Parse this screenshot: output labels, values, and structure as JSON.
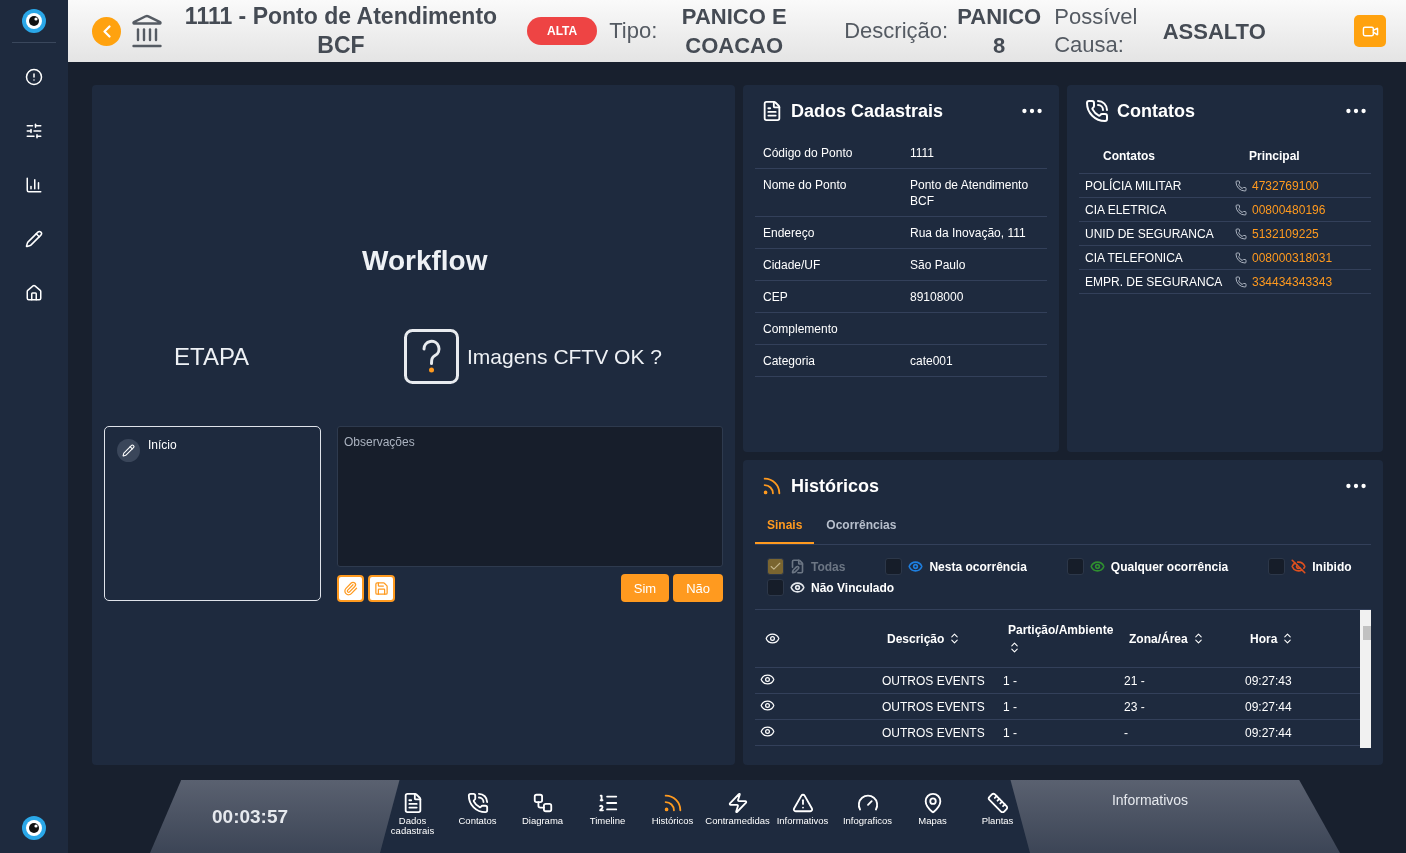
{
  "header": {
    "title": "1111 - Ponto de Atendimento BCF",
    "priority": "ALTA",
    "fields": [
      {
        "label": "Tipo:",
        "value": "PANICO E COACAO"
      },
      {
        "label": "Descrição:",
        "value": "PANICO 8"
      },
      {
        "label": "Possível Causa:",
        "value": "ASSALTO"
      }
    ]
  },
  "workflow": {
    "title": "Workflow",
    "stage_label": "ETAPA",
    "question": "Imagens CFTV OK ?",
    "steps": [
      {
        "label": "Início"
      }
    ],
    "notes": {
      "placeholder": "Observações"
    },
    "buttons": [
      "Sim",
      "Não"
    ]
  },
  "dados": {
    "title": "Dados Cadastrais",
    "rows": [
      {
        "label": "Código do Ponto",
        "value": "1111"
      },
      {
        "label": "Nome do Ponto",
        "value": "Ponto de Atendimento BCF"
      },
      {
        "label": "Endereço",
        "value": "Rua da Inovação, 111"
      },
      {
        "label": "Cidade/UF",
        "value": "São Paulo"
      },
      {
        "label": "CEP",
        "value": "89108000"
      },
      {
        "label": "Complemento"
      },
      {
        "label": "Categoria",
        "value": "cate001"
      }
    ]
  },
  "contatos": {
    "title": "Contatos",
    "columns": [
      "Contatos",
      "Principal"
    ],
    "rows": [
      {
        "name": "POLÍCIA MILITAR",
        "phone": "4732769100"
      },
      {
        "name": "CIA ELETRICA",
        "phone": "00800480196"
      },
      {
        "name": "UNID DE SEGURANCA",
        "phone": "5132109225"
      },
      {
        "name": "CIA TELEFONICA",
        "phone": "008000318031"
      },
      {
        "name": "EMPR. DE SEGURANCA",
        "phone": "334434343343"
      }
    ]
  },
  "historicos": {
    "title": "Históricos",
    "tabs": [
      {
        "label": "Sinais",
        "selected": true
      },
      {
        "label": "Ocorrências",
        "selected": false
      }
    ],
    "filters": [
      {
        "label": "Todas",
        "kind": "note",
        "checked": true,
        "disabled": true,
        "color": "#6c7684"
      },
      {
        "label": "Nesta ocorrência",
        "kind": "eye",
        "checked": false,
        "disabled": false,
        "color": "#1e7fe0"
      },
      {
        "label": "Qualquer ocorrência",
        "kind": "eye",
        "checked": false,
        "disabled": false,
        "color": "#2f8f2f"
      },
      {
        "label": "Inibido",
        "kind": "eye-off",
        "checked": false,
        "disabled": false,
        "color": "#e0501e"
      },
      {
        "label": "Não Vinculado",
        "kind": "eye",
        "checked": false,
        "disabled": false,
        "color": "#e6e9ee"
      }
    ],
    "columns": [
      "Descrição",
      "Partição/Ambiente",
      "Zona/Área",
      "Hora"
    ],
    "rows": [
      {
        "description": "OUTROS EVENTS",
        "partition": "1 -",
        "zone": "21 -",
        "time": "09:27:43"
      },
      {
        "description": "OUTROS EVENTS",
        "partition": "1 -",
        "zone": "23 -",
        "time": "09:27:44"
      },
      {
        "description": "OUTROS EVENTS",
        "partition": "1 -",
        "zone": "-",
        "time": "09:27:44"
      }
    ]
  },
  "dock": {
    "timer": "00:03:57",
    "items": [
      {
        "label": "Dados cadastrais",
        "kind": "document"
      },
      {
        "label": "Contatos",
        "kind": "phone"
      },
      {
        "label": "Diagrama",
        "kind": "diagram"
      },
      {
        "label": "Timeline",
        "kind": "timeline"
      },
      {
        "label": "Históricos",
        "kind": "signal"
      },
      {
        "label": "Contramedidas",
        "kind": "bolt"
      },
      {
        "label": "Informativos",
        "kind": "warning"
      },
      {
        "label": "Infograficos",
        "kind": "gauge"
      },
      {
        "label": "Mapas",
        "kind": "pin"
      },
      {
        "label": "Plantas",
        "kind": "ruler"
      }
    ],
    "side_label": "Informativos"
  }
}
